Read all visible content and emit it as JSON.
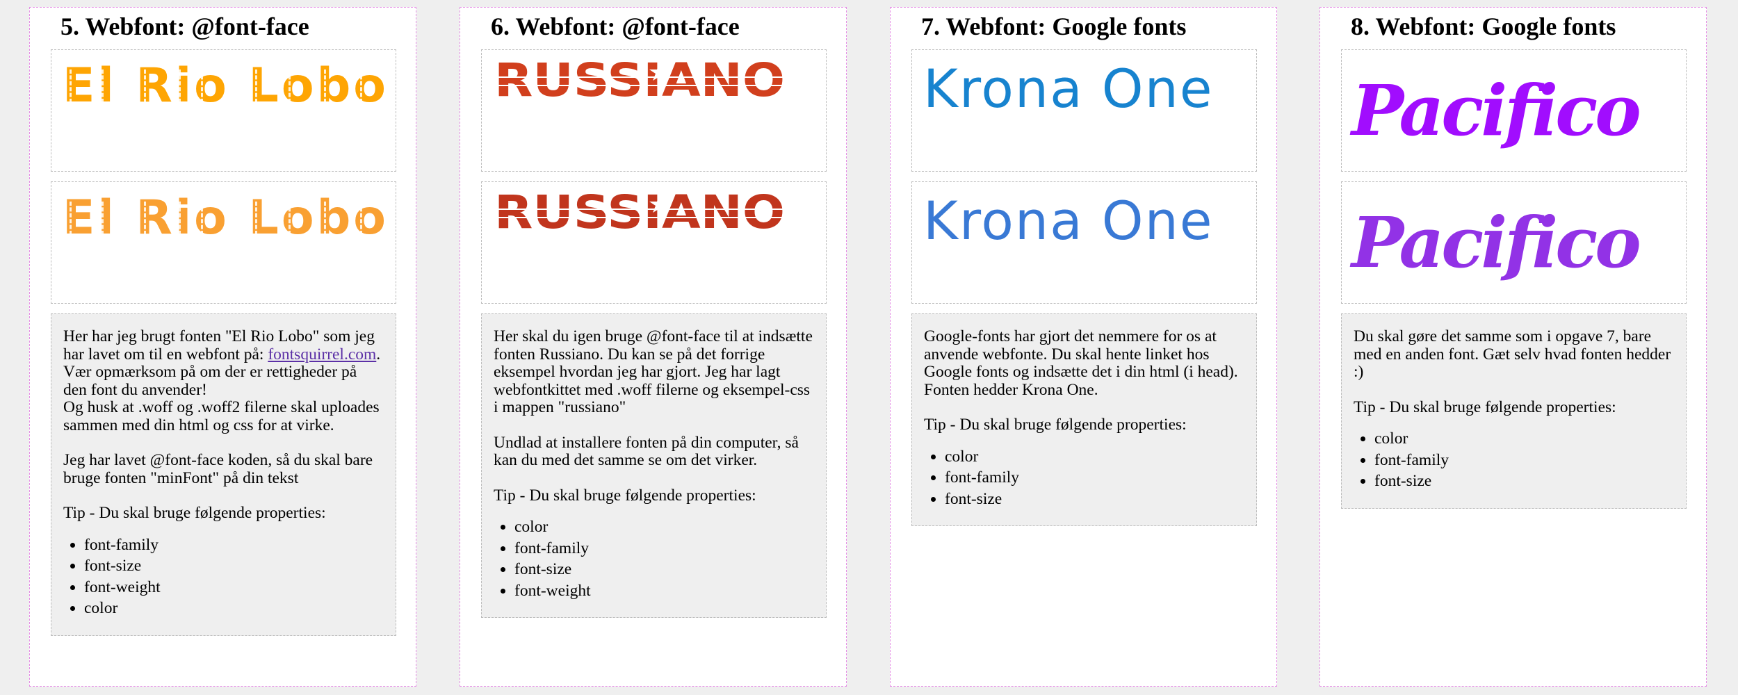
{
  "colors": {
    "page_bg": "#efefef",
    "column_border": "#e58ee5",
    "box_border": "#bcbcbc",
    "info_bg": "#efefef",
    "riolobo_1": "#fea503",
    "riolobo_2": "#f9a032",
    "russiano_1": "#d13f1d",
    "russiano_2": "#c1351d",
    "krona_1": "#1783cf",
    "krona_2": "#3979d5",
    "pacifico_1": "#a10dfe",
    "pacifico_2": "#9232e6",
    "link": "#5b2fa6"
  },
  "tasks": [
    {
      "heading": "5. Webfont: @font-face",
      "sample_text": "El Rio Lobo",
      "paragraphs": [
        "Her har jeg brugt fonten \"El Rio Lobo\" som jeg har lavet om til en webfont på:",
        "Jeg har lavet @font-face koden, så du skal bare bruge fonten \"minFont\" på din tekst",
        "Tip - Du skal bruge følgende properties:"
      ],
      "link_text": "fontsquirrel.com",
      "after_link": ". Vær opmærksom på om der er rettigheder på den font du anvender!",
      "second_line": "Og husk at .woff og .woff2 filerne skal uploades sammen med din html og css for at virke.",
      "properties": [
        "font-family",
        "font-size",
        "font-weight",
        "color"
      ]
    },
    {
      "heading": "6. Webfont: @font-face",
      "sample_text": "RUSSIANO",
      "paragraphs": [
        "Her skal du igen bruge @font-face til at indsætte fonten Russiano. Du kan se på det forrige eksempel hvordan jeg har gjort. Jeg har lagt webfontkittet med .woff filerne og eksempel-css i mappen \"russiano\"",
        "Undlad at installere fonten på din computer, så kan du med det samme se om det virker.",
        "Tip - Du skal bruge følgende properties:"
      ],
      "properties": [
        "color",
        "font-family",
        "font-size",
        "font-weight"
      ]
    },
    {
      "heading": "7. Webfont: Google fonts",
      "sample_text": "Krona One",
      "paragraphs": [
        "Google-fonts har gjort det nemmere for os at anvende webfonte. Du skal hente linket hos Google fonts og indsætte det i din html (i head). Fonten hedder Krona One.",
        "Tip - Du skal bruge følgende properties:"
      ],
      "properties": [
        "color",
        "font-family",
        "font-size"
      ]
    },
    {
      "heading": "8. Webfont: Google fonts",
      "sample_text": "Pacifico",
      "paragraphs": [
        "Du skal gøre det samme som i opgave 7, bare med en anden font. Gæt selv hvad fonten hedder :)",
        "Tip - Du skal bruge følgende properties:"
      ],
      "properties": [
        "color",
        "font-family",
        "font-size"
      ]
    }
  ]
}
